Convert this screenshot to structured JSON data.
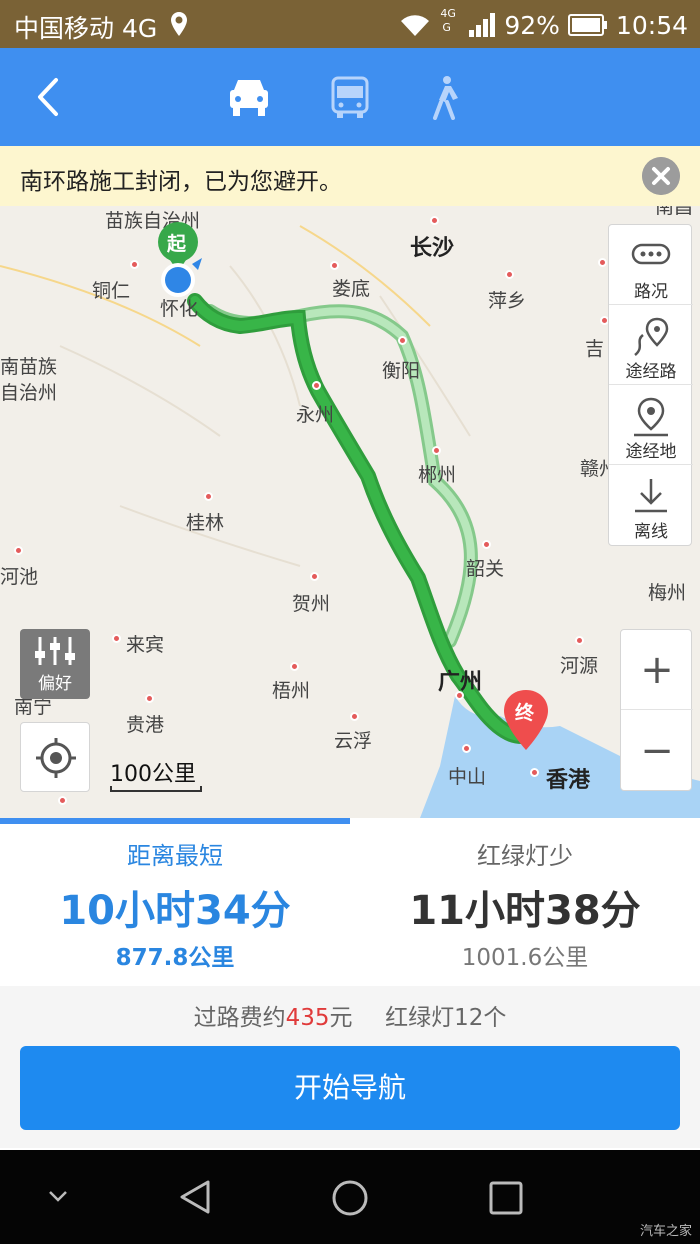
{
  "status_bar": {
    "carrier": "中国移动 4G",
    "battery": "92%",
    "time": "10:54",
    "signal_tag_top": "4G",
    "signal_tag_bottom": "G"
  },
  "nav": {
    "back_icon": "chevron-left-icon",
    "modes": [
      "car-icon",
      "bus-icon",
      "walk-icon"
    ],
    "selected_mode": "car-icon"
  },
  "notice": {
    "text": "南环路施工封闭，已为您避开。"
  },
  "map": {
    "start_label": "起",
    "end_label": "终",
    "cities": [
      "苗族自治州",
      "长沙",
      "铜仁",
      "娄底",
      "怀化",
      "萍乡",
      "南苗族",
      "自治州",
      "衡阳",
      "吉",
      "永州",
      "郴州",
      "赣州",
      "桂林",
      "韶关",
      "河池",
      "贺州",
      "梅州",
      "来宾",
      "河源",
      "南宁",
      "梧州",
      "广州",
      "贵港",
      "云浮",
      "中山",
      "香港",
      "南昌"
    ],
    "scale": "100公里",
    "preference": "偏好",
    "route_colors": {
      "selected": "#38b548",
      "alternative": "#a5e2a9"
    }
  },
  "map_tools": [
    {
      "label": "路况",
      "icon": "traffic-icon"
    },
    {
      "label": "途经路",
      "icon": "via-road-icon"
    },
    {
      "label": "途经地",
      "icon": "via-place-icon"
    },
    {
      "label": "离线",
      "icon": "offline-download-icon"
    }
  ],
  "zoom": {
    "in": "+",
    "out": "−"
  },
  "routes": [
    {
      "name": "距离最短",
      "time": "10小时34分",
      "distance": "877.8公里"
    },
    {
      "name": "红绿灯少",
      "time": "11小时38分",
      "distance": "1001.6公里"
    }
  ],
  "summary": {
    "toll_prefix": "过路费约",
    "toll_value": "435",
    "toll_suffix": "元",
    "lights": "红绿灯12个"
  },
  "start_button": "开始导航",
  "watermark": "汽车之家"
}
